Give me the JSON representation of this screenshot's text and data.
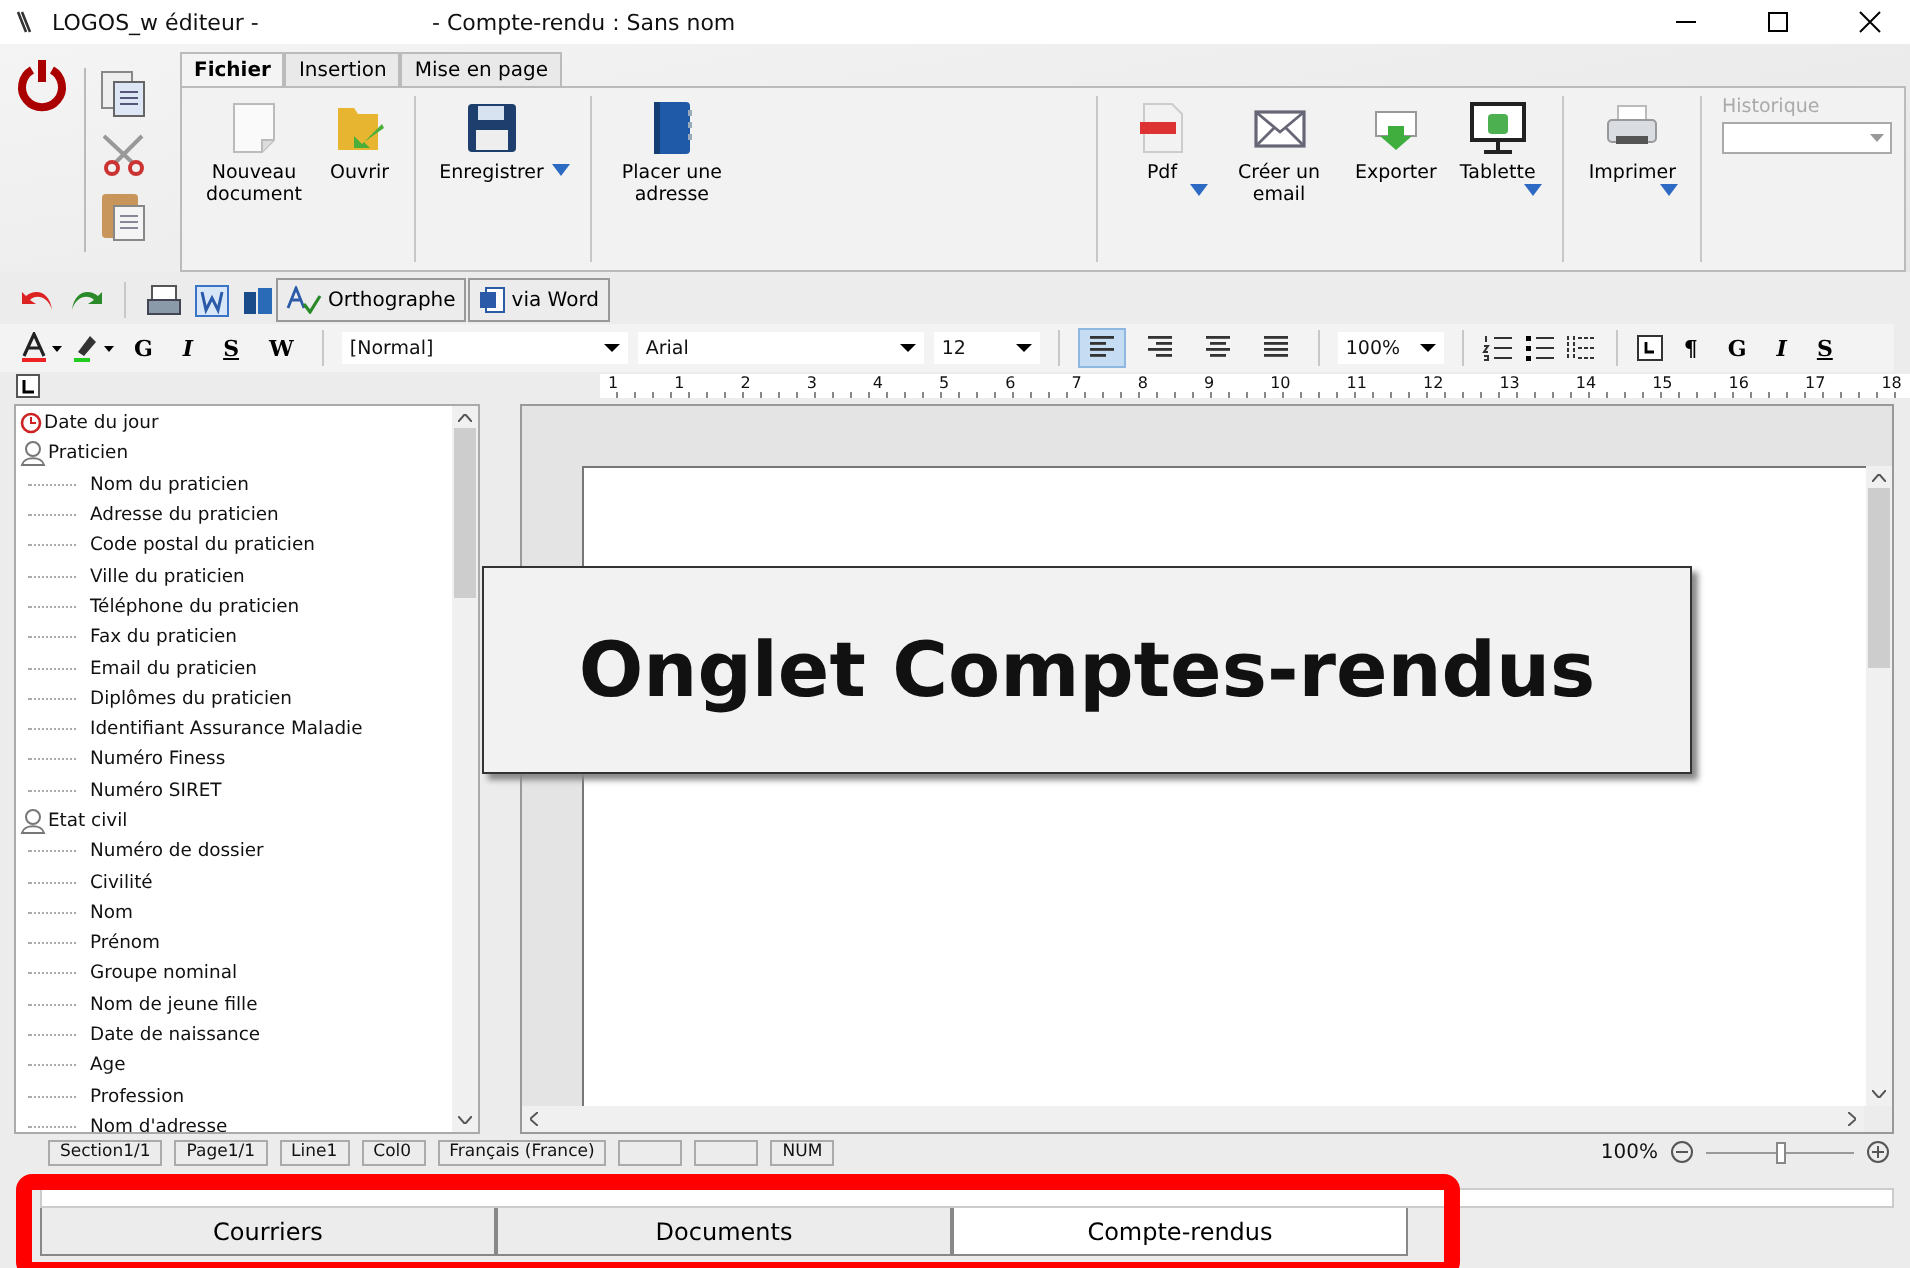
{
  "window": {
    "app_title": "LOGOS_w éditeur -",
    "doc_title": "- Compte-rendu  : Sans nom"
  },
  "ribbon": {
    "tabs": [
      {
        "label": "Fichier",
        "selected": true
      },
      {
        "label": "Insertion",
        "selected": false
      },
      {
        "label": "Mise en page",
        "selected": false
      }
    ],
    "left_buttons": [
      {
        "kind": "new",
        "label": "Nouveau document",
        "dropdown": false
      },
      {
        "kind": "open",
        "label": "Ouvrir",
        "dropdown": false
      },
      {
        "kind": "save",
        "label": "Enregistrer",
        "dropdown": true
      },
      {
        "kind": "book",
        "label": "Placer une adresse",
        "dropdown": false
      }
    ],
    "right_buttons": [
      {
        "kind": "pdf",
        "label": "Pdf",
        "dropdown": true
      },
      {
        "kind": "mail",
        "label": "Créer un email",
        "dropdown": false
      },
      {
        "kind": "export",
        "label": "Exporter",
        "dropdown": false
      },
      {
        "kind": "tablet",
        "label": "Tablette",
        "dropdown": true
      },
      {
        "kind": "print",
        "label": "Imprimer",
        "dropdown": true
      }
    ],
    "history": {
      "label": "Historique",
      "disabled": true
    }
  },
  "toolbar": {
    "spell_button": "Orthographe",
    "word_button": "via Word"
  },
  "format": {
    "char_buttons": [
      "G",
      "I",
      "S",
      "W"
    ],
    "style": "[Normal]",
    "font": "Arial",
    "size": "12",
    "align": [
      {
        "kind": "left",
        "selected": true
      },
      {
        "kind": "right",
        "selected": false
      },
      {
        "kind": "center",
        "selected": false
      },
      {
        "kind": "justify",
        "selected": false
      }
    ],
    "zoom": "100%",
    "extra_buttons": [
      "¶",
      "G",
      "I",
      "S"
    ]
  },
  "ruler": [
    "1",
    "1",
    "2",
    "3",
    "4",
    "5",
    "6",
    "7",
    "8",
    "9",
    "10",
    "11",
    "12",
    "13",
    "14",
    "15",
    "16",
    "17",
    "18"
  ],
  "tree": [
    {
      "label": "Date du jour",
      "kind": "clock"
    },
    {
      "label": "Praticien",
      "kind": "person",
      "children": [
        {
          "label": "Nom du praticien"
        },
        {
          "label": "Adresse du praticien"
        },
        {
          "label": "Code postal du praticien"
        },
        {
          "label": "Ville du praticien"
        },
        {
          "label": "Téléphone du praticien"
        },
        {
          "label": "Fax du praticien"
        },
        {
          "label": "Email du praticien"
        },
        {
          "label": "Diplômes du praticien"
        },
        {
          "label": "Identifiant Assurance Maladie"
        },
        {
          "label": "Numéro Finess"
        },
        {
          "label": "Numéro SIRET"
        }
      ]
    },
    {
      "label": "Etat civil",
      "kind": "person",
      "children": [
        {
          "label": "Numéro de dossier"
        },
        {
          "label": "Civilité"
        },
        {
          "label": "Nom"
        },
        {
          "label": "Prénom"
        },
        {
          "label": "Groupe nominal"
        },
        {
          "label": "Nom de jeune fille"
        },
        {
          "label": "Date de naissance"
        },
        {
          "label": "Age"
        },
        {
          "label": "Profession"
        },
        {
          "label": "Nom d'adresse"
        }
      ]
    }
  ],
  "callout": "Onglet Comptes-rendus",
  "status_bar": {
    "items": [
      "Section1/1",
      "Page1/1",
      "Line1",
      "Col0",
      "Français (France)",
      "NUM"
    ],
    "zoom": "100%",
    "zoom_slider": {
      "level": 0.5
    }
  },
  "bottom_tabs": [
    {
      "label": "Courriers",
      "selected": false
    },
    {
      "label": "Documents",
      "selected": false
    },
    {
      "label": "Compte-rendus",
      "selected": true
    }
  ]
}
